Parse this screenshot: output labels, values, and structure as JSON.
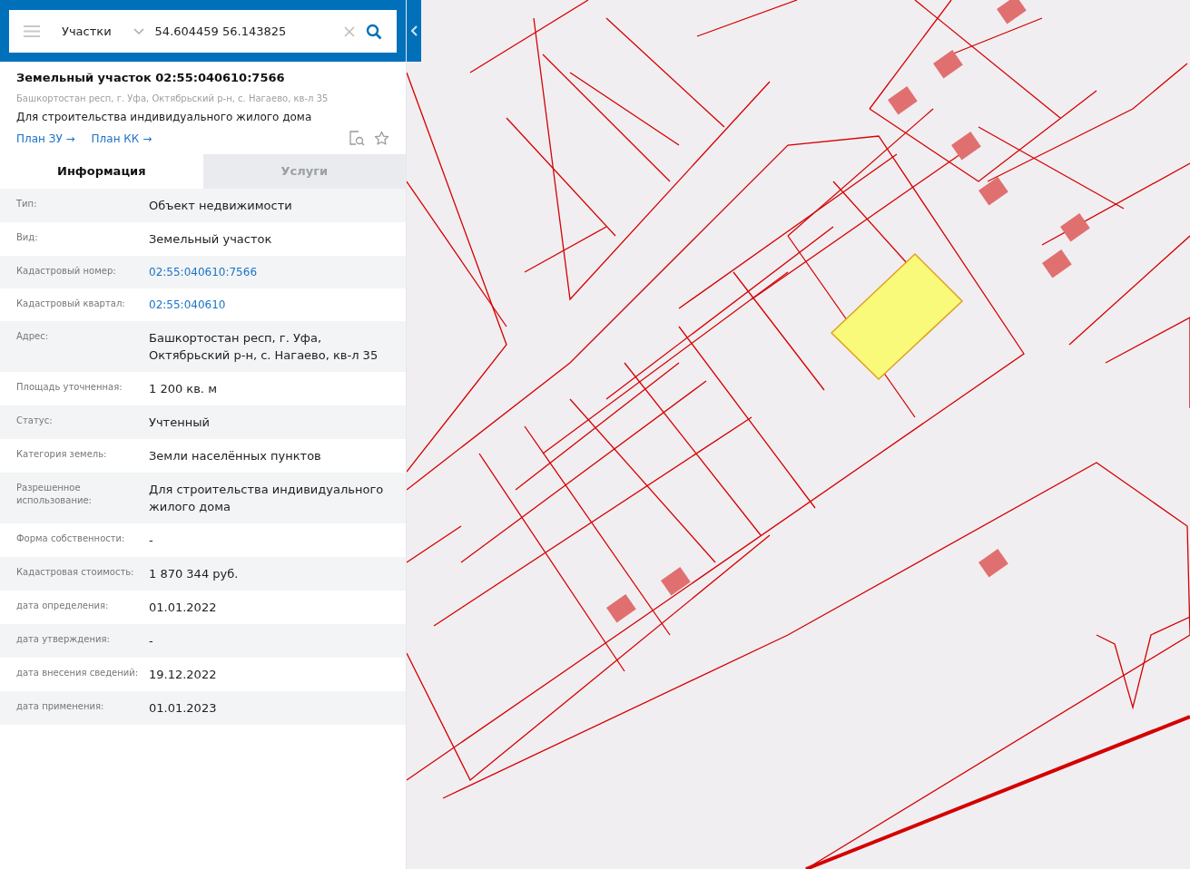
{
  "search": {
    "layer": "Участки",
    "value": "54.604459 56.143825"
  },
  "object": {
    "title": "Земельный участок 02:55:040610:7566",
    "address": "Башкортостан респ, г. Уфа, Октябрьский р-н, с. Нагаево, кв-л 35",
    "purpose": "Для строительства индивидуального жилого дома",
    "links": [
      "План ЗУ →",
      "План КК →"
    ]
  },
  "tabs": [
    {
      "label": "Информация",
      "selected": true
    },
    {
      "label": "Услуги",
      "selected": false
    }
  ],
  "rows": [
    {
      "label": "Тип:",
      "value": "Объект недвижимости",
      "kind": "text"
    },
    {
      "label": "Вид:",
      "value": "Земельный участок",
      "kind": "text"
    },
    {
      "label": "Кадастровый номер:",
      "value": "02:55:040610:7566",
      "kind": "link"
    },
    {
      "label": "Кадастровый квартал:",
      "value": "02:55:040610",
      "kind": "link"
    },
    {
      "label": "Адрес:",
      "value": "Башкортостан респ, г. Уфа, Октябрьский р-н, с. Нагаево, кв-л 35",
      "kind": "text"
    },
    {
      "label": "Площадь уточненная:",
      "value": "1 200 кв. м",
      "kind": "text"
    },
    {
      "label": "Статус:",
      "value": "Учтенный",
      "kind": "text"
    },
    {
      "label": "Категория земель:",
      "value": "Земли населённых пунктов",
      "kind": "text"
    },
    {
      "label": "Разрешенное использование:",
      "value": "Для строительства индивидуального жилого дома",
      "kind": "text"
    },
    {
      "label": "Форма собственности:",
      "value": "-",
      "kind": "text"
    },
    {
      "label": "Кадастровая стоимость:",
      "value": "1 870 344 руб.",
      "kind": "text"
    },
    {
      "label": "дата определения:",
      "value": "01.01.2022",
      "kind": "text"
    },
    {
      "label": "дата утверждения:",
      "value": "-",
      "kind": "text"
    },
    {
      "label": "дата внесения сведений:",
      "value": "19.12.2022",
      "kind": "text"
    },
    {
      "label": "дата применения:",
      "value": "01.01.2023",
      "kind": "text"
    }
  ]
}
